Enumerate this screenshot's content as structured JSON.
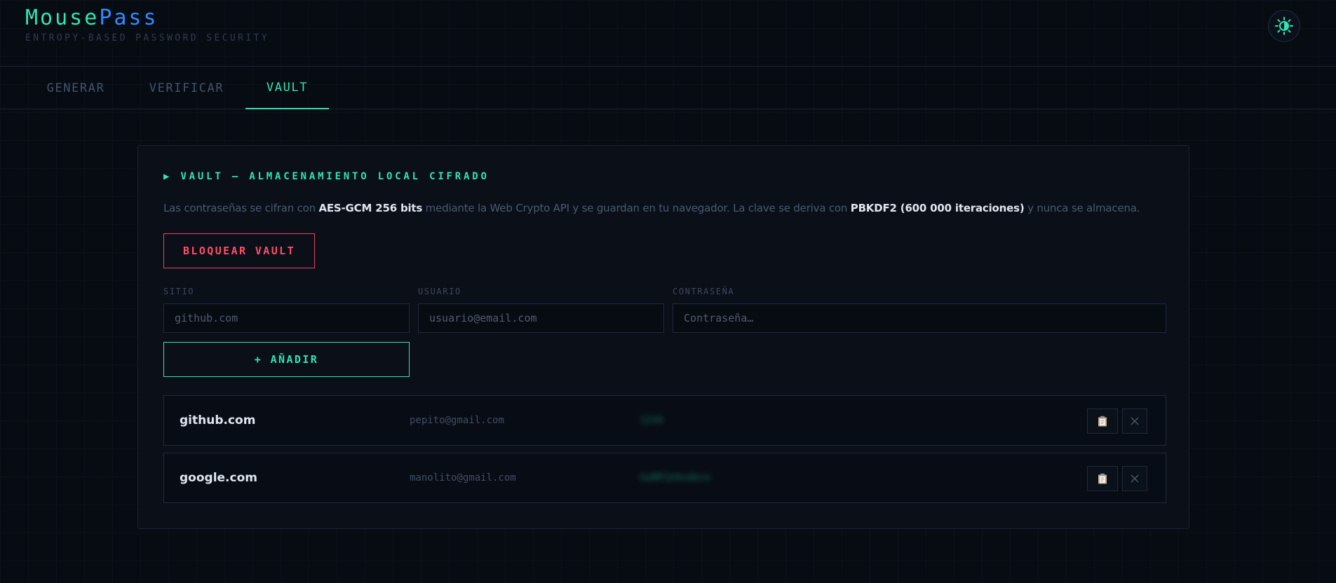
{
  "app": {
    "title_part1": "Mouse",
    "title_part2": "Pass",
    "tagline": "ENTROPY-BASED PASSWORD SECURITY"
  },
  "tabs": [
    {
      "label": "GENERAR",
      "active": false
    },
    {
      "label": "VERIFICAR",
      "active": false
    },
    {
      "label": "VAULT",
      "active": true
    }
  ],
  "vault": {
    "title": "▶ VAULT — ALMACENAMIENTO LOCAL CIFRADO",
    "description": {
      "t1": "Las contraseñas se cifran con ",
      "b1": "AES-GCM 256 bits",
      "t2": " mediante la Web Crypto API y se guardan en tu navegador. La clave se deriva con ",
      "b2": "PBKDF2 (600 000 iteraciones)",
      "t3": " y nunca se almacena."
    },
    "lock_label": "BLOQUEAR VAULT",
    "form": {
      "site_label": "SITIO",
      "site_placeholder": "github.com",
      "user_label": "USUARIO",
      "user_placeholder": "usuario@email.com",
      "pass_label": "CONTRASEÑA",
      "pass_placeholder": "Contraseña…",
      "add_label": "+ AÑADIR"
    },
    "entries": [
      {
        "site": "github.com",
        "user": "pepito@gmail.com",
        "password": "1234"
      },
      {
        "site": "google.com",
        "user": "manolito@gmail.com",
        "password": "SuMP1h9vdkre"
      }
    ]
  },
  "icons": {
    "theme": "sun-bug-icon",
    "copy": "clipboard-icon",
    "delete": "close-icon"
  },
  "colors": {
    "accent": "#2ee6b3",
    "accent_blue": "#2f8bff",
    "danger": "#ff4d6a",
    "background": "#070b12"
  }
}
